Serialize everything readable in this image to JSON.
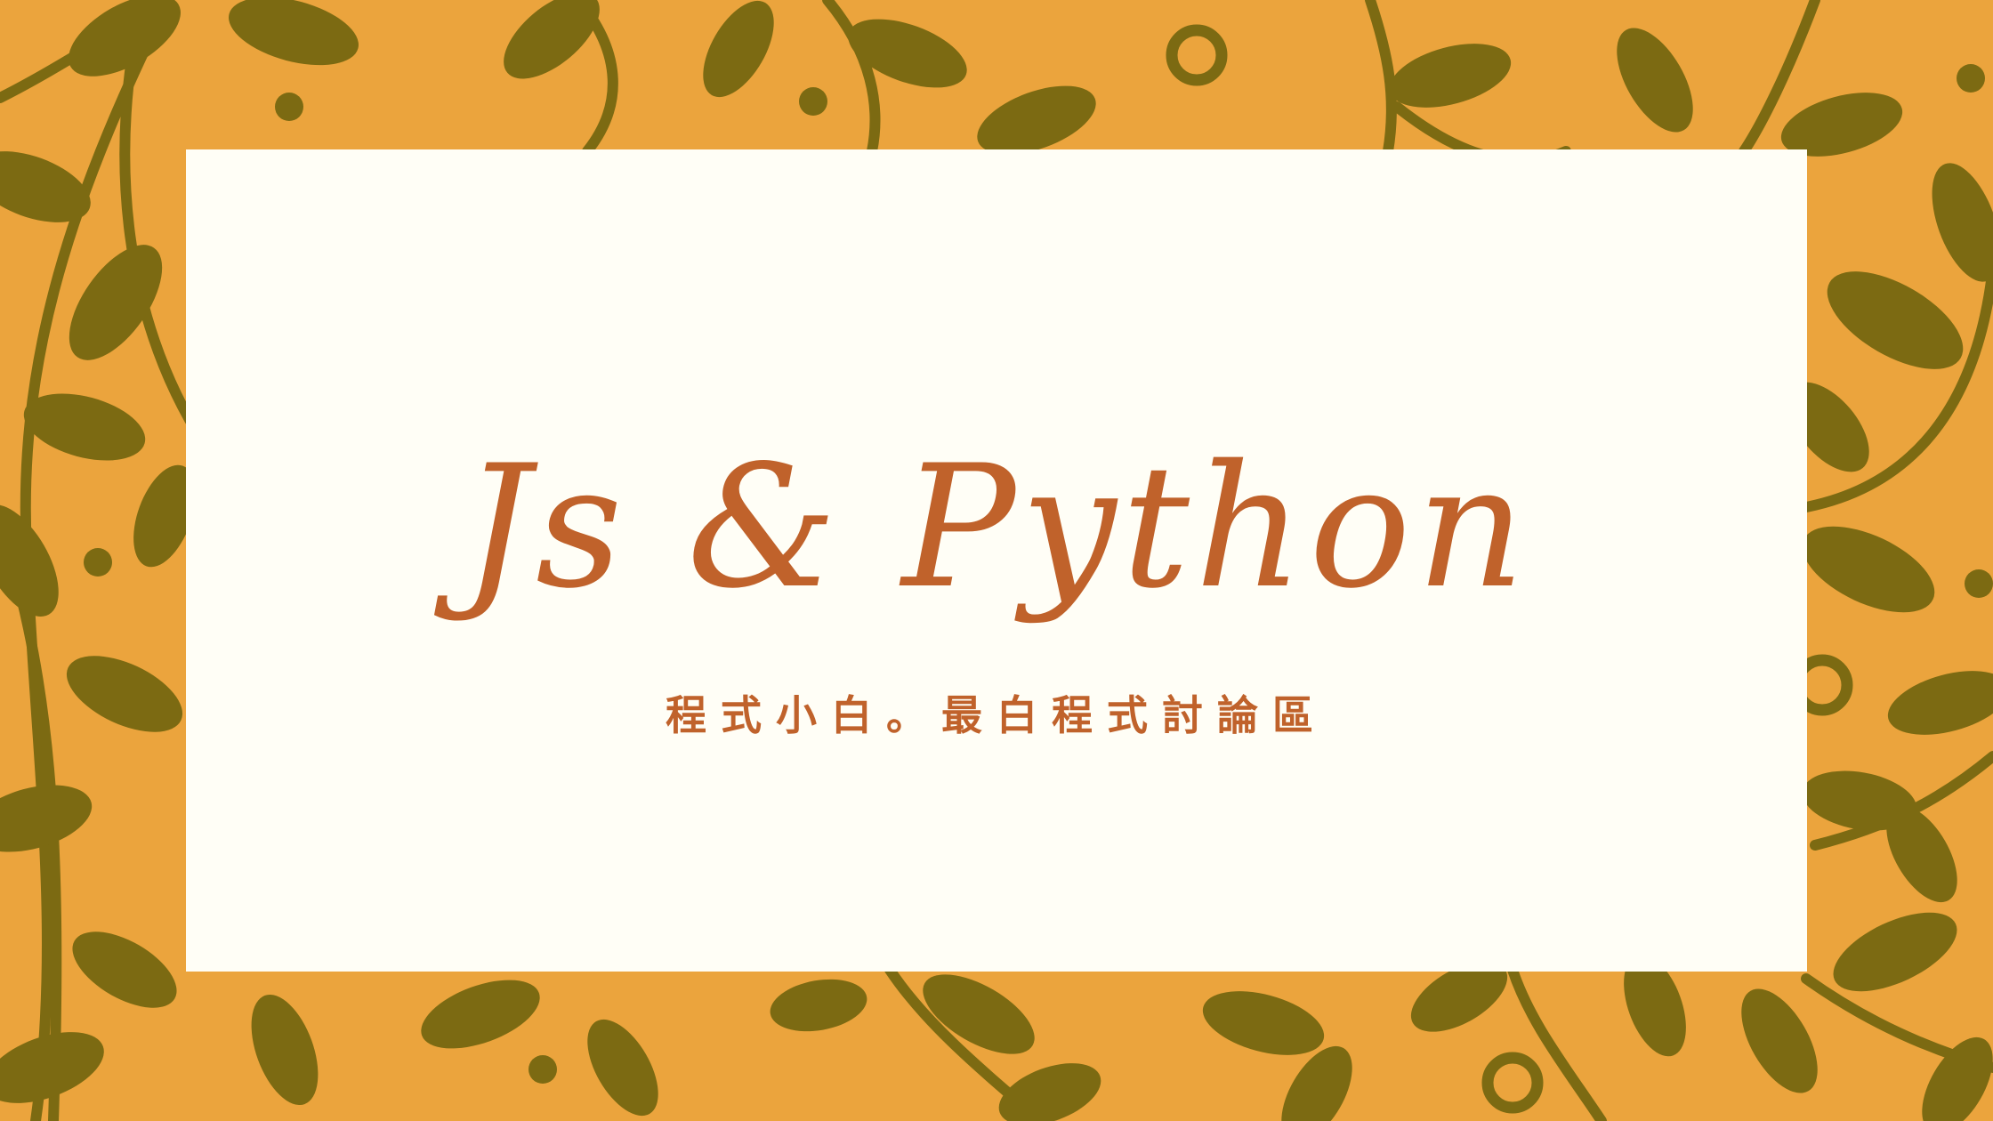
{
  "banner": {
    "title": "Js & Python",
    "subtitle": "程式小白。最白程式討論區"
  },
  "colors": {
    "background": "#eba43d",
    "leaf": "#7c6a12",
    "card": "#fffef6",
    "text": "#c0622b"
  },
  "icons": {
    "background_pattern": "leaf-vine-pattern"
  }
}
